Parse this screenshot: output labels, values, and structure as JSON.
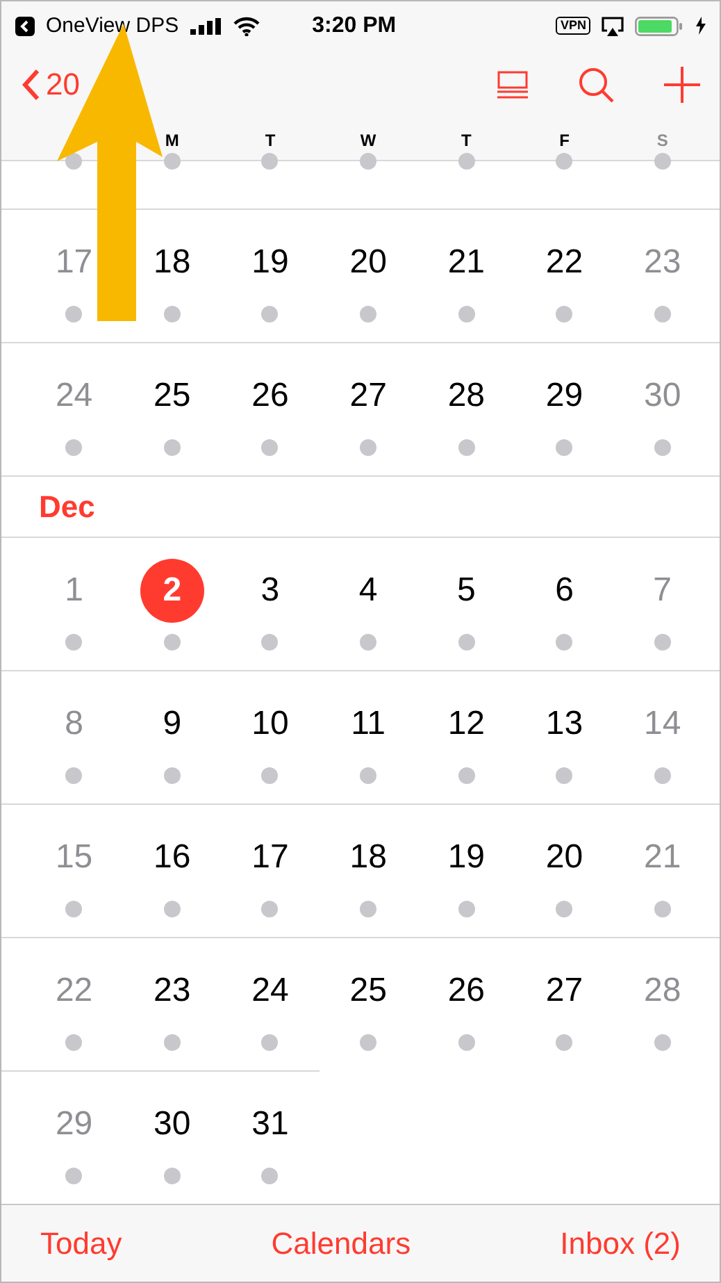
{
  "status_bar": {
    "back_app": "OneView DPS",
    "time": "3:20 PM",
    "vpn": "VPN"
  },
  "nav_bar": {
    "back_label": "20"
  },
  "weekdays": [
    {
      "label": "M",
      "weekend": false
    },
    {
      "label": "T",
      "weekend": false
    },
    {
      "label": "W",
      "weekend": false
    },
    {
      "label": "T",
      "weekend": false
    },
    {
      "label": "F",
      "weekend": false
    },
    {
      "label": "S",
      "weekend": true
    }
  ],
  "sections": [
    {
      "weeks": [
        {
          "cut": true
        },
        {
          "days": [
            {
              "day": "17",
              "weekend": true,
              "selected": false
            },
            {
              "day": "18",
              "weekend": false,
              "selected": false
            },
            {
              "day": "19",
              "weekend": false,
              "selected": false
            },
            {
              "day": "20",
              "weekend": false,
              "selected": false
            },
            {
              "day": "21",
              "weekend": false,
              "selected": false
            },
            {
              "day": "22",
              "weekend": false,
              "selected": false
            },
            {
              "day": "23",
              "weekend": true,
              "selected": false
            }
          ]
        },
        {
          "days": [
            {
              "day": "24",
              "weekend": true,
              "selected": false
            },
            {
              "day": "25",
              "weekend": false,
              "selected": false
            },
            {
              "day": "26",
              "weekend": false,
              "selected": false
            },
            {
              "day": "27",
              "weekend": false,
              "selected": false
            },
            {
              "day": "28",
              "weekend": false,
              "selected": false
            },
            {
              "day": "29",
              "weekend": false,
              "selected": false
            },
            {
              "day": "30",
              "weekend": true,
              "selected": false
            }
          ]
        }
      ]
    },
    {
      "month": "Dec",
      "weeks": [
        {
          "days": [
            {
              "day": "1",
              "weekend": true,
              "selected": false
            },
            {
              "day": "2",
              "weekend": false,
              "selected": true
            },
            {
              "day": "3",
              "weekend": false,
              "selected": false
            },
            {
              "day": "4",
              "weekend": false,
              "selected": false
            },
            {
              "day": "5",
              "weekend": false,
              "selected": false
            },
            {
              "day": "6",
              "weekend": false,
              "selected": false
            },
            {
              "day": "7",
              "weekend": true,
              "selected": false
            }
          ]
        },
        {
          "days": [
            {
              "day": "8",
              "weekend": true,
              "selected": false
            },
            {
              "day": "9",
              "weekend": false,
              "selected": false
            },
            {
              "day": "10",
              "weekend": false,
              "selected": false
            },
            {
              "day": "11",
              "weekend": false,
              "selected": false
            },
            {
              "day": "12",
              "weekend": false,
              "selected": false
            },
            {
              "day": "13",
              "weekend": false,
              "selected": false
            },
            {
              "day": "14",
              "weekend": true,
              "selected": false
            }
          ]
        },
        {
          "days": [
            {
              "day": "15",
              "weekend": true,
              "selected": false
            },
            {
              "day": "16",
              "weekend": false,
              "selected": false
            },
            {
              "day": "17",
              "weekend": false,
              "selected": false
            },
            {
              "day": "18",
              "weekend": false,
              "selected": false
            },
            {
              "day": "19",
              "weekend": false,
              "selected": false
            },
            {
              "day": "20",
              "weekend": false,
              "selected": false
            },
            {
              "day": "21",
              "weekend": true,
              "selected": false
            }
          ]
        },
        {
          "days": [
            {
              "day": "22",
              "weekend": true,
              "selected": false
            },
            {
              "day": "23",
              "weekend": false,
              "selected": false
            },
            {
              "day": "24",
              "weekend": false,
              "selected": false
            },
            {
              "day": "25",
              "weekend": false,
              "selected": false
            },
            {
              "day": "26",
              "weekend": false,
              "selected": false
            },
            {
              "day": "27",
              "weekend": false,
              "selected": false
            },
            {
              "day": "28",
              "weekend": true,
              "selected": false
            }
          ]
        },
        {
          "days": [
            {
              "day": "29",
              "weekend": true,
              "selected": false
            },
            {
              "day": "30",
              "weekend": false,
              "selected": false
            },
            {
              "day": "31",
              "weekend": false,
              "selected": false
            }
          ]
        }
      ]
    }
  ],
  "tab_bar": [
    "Today",
    "Calendars",
    "Inbox (2)"
  ]
}
